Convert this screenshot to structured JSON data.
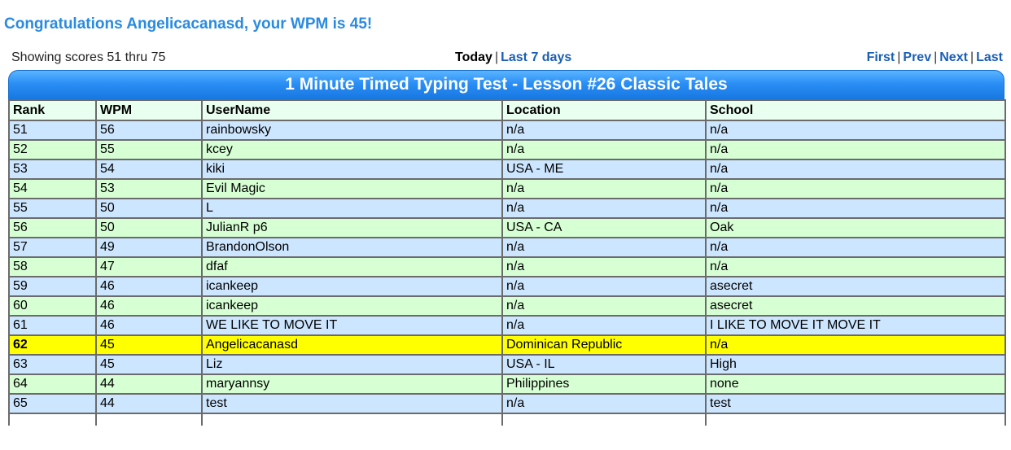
{
  "congrats": "Congratulations Angelicacanasd, your WPM is 45!",
  "nav": {
    "showing": "Showing scores 51 thru 75",
    "today": "Today",
    "last7": "Last 7 days",
    "first": "First",
    "prev": "Prev",
    "next": "Next",
    "last": "Last",
    "sep": "|"
  },
  "table": {
    "title": "1 Minute Timed Typing Test - Lesson #26 Classic Tales",
    "headers": [
      "Rank",
      "WPM",
      "UserName",
      "Location",
      "School"
    ],
    "rows": [
      [
        "51",
        "56",
        "rainbowsky",
        "n/a",
        "n/a"
      ],
      [
        "52",
        "55",
        "kcey",
        "n/a",
        "n/a"
      ],
      [
        "53",
        "54",
        "kiki",
        "USA - ME",
        "n/a"
      ],
      [
        "54",
        "53",
        "Evil Magic",
        "n/a",
        "n/a"
      ],
      [
        "55",
        "50",
        "L",
        "n/a",
        "n/a"
      ],
      [
        "56",
        "50",
        "JulianR p6",
        "USA - CA",
        "Oak"
      ],
      [
        "57",
        "49",
        "BrandonOlson",
        "n/a",
        "n/a"
      ],
      [
        "58",
        "47",
        "dfaf",
        "n/a",
        "n/a"
      ],
      [
        "59",
        "46",
        "icankeep",
        "n/a",
        "asecret"
      ],
      [
        "60",
        "46",
        "icankeep",
        "n/a",
        "asecret"
      ],
      [
        "61",
        "46",
        "WE LIKE TO MOVE IT",
        "n/a",
        "I LIKE TO MOVE IT MOVE IT"
      ],
      [
        "62",
        "45",
        "Angelicacanasd",
        "Dominican Republic",
        "n/a"
      ],
      [
        "63",
        "45",
        "Liz",
        "USA - IL",
        "High"
      ],
      [
        "64",
        "44",
        "maryannsy",
        "Philippines",
        "none"
      ],
      [
        "65",
        "44",
        "test",
        "n/a",
        "test"
      ]
    ],
    "highlight_rank": "62"
  },
  "colors": {
    "congrats": "#2a8be0",
    "link": "#1a5fb4",
    "row_blue": "#cde6ff",
    "row_green": "#d6ffd3",
    "row_highlight": "#ffff00",
    "header_bg": "#e9fff0"
  }
}
